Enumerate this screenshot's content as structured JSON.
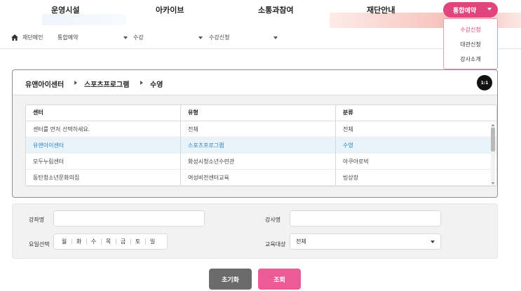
{
  "nav": {
    "items": [
      "운영시설",
      "아카이브",
      "소통과참여",
      "재단안내"
    ],
    "booking_label": "통합예약",
    "dropdown": [
      "수강신청",
      "대관신청",
      "강사소개"
    ],
    "accent": "#e0457b"
  },
  "breadcrumb": {
    "home_icon": "home-icon",
    "items": [
      "재단메인",
      "통합예약",
      "수강",
      "수강신청"
    ]
  },
  "selection": {
    "path": [
      "유앤아이센터",
      "스포츠프로그램",
      "수영"
    ],
    "circle_label": "1:1",
    "centers": {
      "title": "센터",
      "rows": [
        "센터를 먼저 선택하세요.",
        "유앤아이센터",
        "모두누림센터",
        "동탄청소년문화의집"
      ],
      "selected_index": 1
    },
    "types": {
      "title": "유형",
      "rows": [
        "전체",
        "스포츠프로그램",
        "화성시청소년수련관",
        "여성비전센터교육"
      ],
      "selected_index": 1
    },
    "categories": {
      "title": "분류",
      "rows": [
        "전체",
        "수영",
        "아쿠아로빅",
        "빙상장"
      ],
      "selected_index": 1
    }
  },
  "form": {
    "course_label": "강좌명",
    "course_value": "",
    "teacher_label": "강사명",
    "teacher_value": "",
    "day_label": "요일선택",
    "days": [
      "월",
      "화",
      "수",
      "목",
      "금",
      "토",
      "일"
    ],
    "target_label": "교육대상",
    "target_value": "전체"
  },
  "buttons": {
    "reset": "초기화",
    "search": "조회"
  }
}
